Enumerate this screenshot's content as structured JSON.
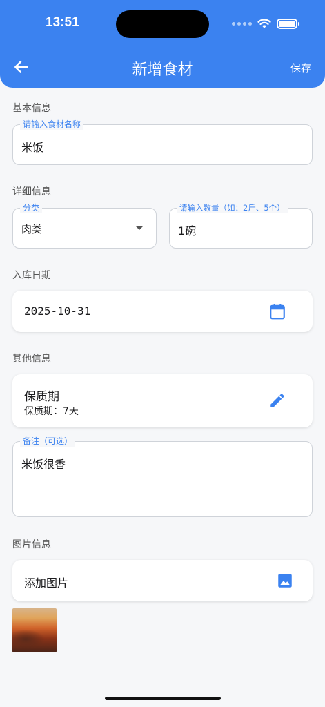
{
  "status_bar": {
    "time": "13:51"
  },
  "header": {
    "title": "新增食材",
    "save_label": "保存",
    "back_icon": "arrow-left-icon"
  },
  "sections": {
    "basic": "基本信息",
    "detail": "详细信息",
    "date": "入库日期",
    "other": "其他信息",
    "image": "图片信息"
  },
  "name_field": {
    "label": "请输入食材名称",
    "value": "米饭"
  },
  "category_field": {
    "label": "分类",
    "value": "肉类"
  },
  "quantity_field": {
    "label": "请输入数量（如：2斤、5个）",
    "value": "1碗"
  },
  "storage_date": {
    "value": "2025-10-31",
    "icon": "calendar-icon"
  },
  "shelf_life": {
    "title": "保质期",
    "subtitle": "保质期：7天",
    "icon": "edit-icon"
  },
  "note_field": {
    "label": "备注（可选）",
    "value": "米饭很香"
  },
  "add_image": {
    "label": "添加图片",
    "icon": "image-icon"
  },
  "colors": {
    "primary": "#3b82f0",
    "background": "#f6f7f9"
  }
}
